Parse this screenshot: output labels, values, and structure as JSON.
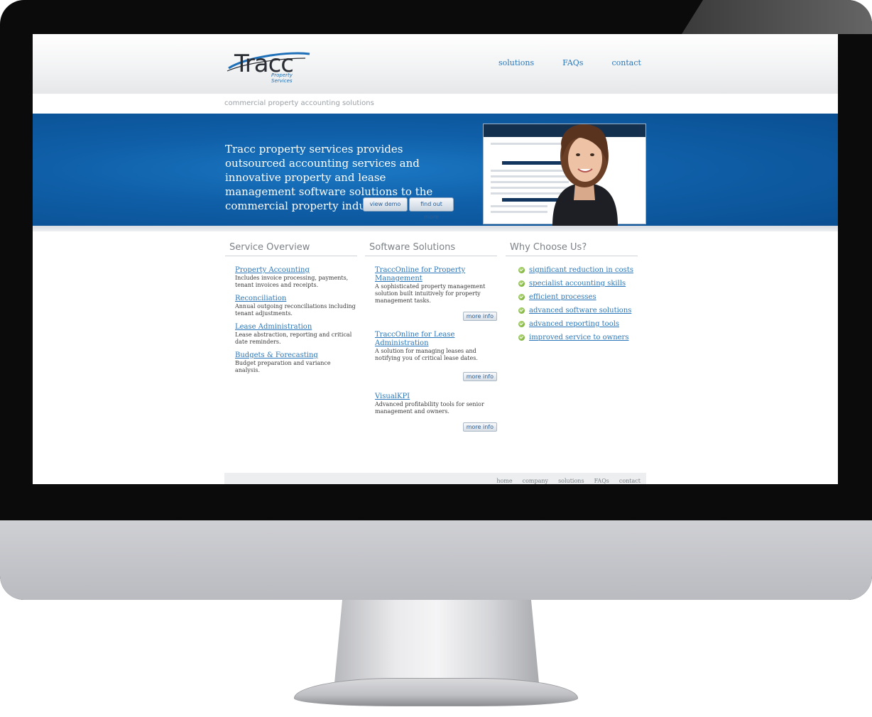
{
  "header": {
    "logo_text": "Tracc",
    "logo_sub": "Property Services",
    "nav": [
      "solutions",
      "FAQs",
      "contact"
    ]
  },
  "tagline": "commercial property accounting solutions",
  "banner": {
    "headline": "Tracc property services provides outsourced accounting services and innovative property and lease management software solutions to the commercial property industry.",
    "btn_demo": "view demo",
    "btn_more": "find out more"
  },
  "service_overview": {
    "heading": "Service Overview",
    "items": [
      {
        "title": "Property Accounting",
        "desc": "Includes invoice processing, payments, tenant invoices and receipts."
      },
      {
        "title": "Reconciliation",
        "desc": "Annual outgoing reconciliations including tenant adjustments."
      },
      {
        "title": "Lease Administration",
        "desc": "Lease abstraction, reporting and critical date reminders."
      },
      {
        "title": "Budgets & Forecasting",
        "desc": "Budget preparation and variance analysis."
      }
    ]
  },
  "software_solutions": {
    "heading": "Software Solutions",
    "more_label": "more info",
    "items": [
      {
        "title": "TraccOnline for Property Management",
        "desc": "A sophisticated property management solution built intuitively for property management tasks."
      },
      {
        "title": "TraccOnline for Lease Administration",
        "desc": "A solution for managing leases and notifying you of critical lease dates."
      },
      {
        "title": "VisualKPI",
        "desc": "Advanced profitability tools for senior management and owners."
      }
    ]
  },
  "why_choose": {
    "heading": "Why Choose Us?",
    "items": [
      "significant reduction in costs",
      "specialist accounting skills",
      "efficient processes",
      "advanced software solutions",
      "advanced reporting tools",
      "improved service to owners"
    ]
  },
  "footer": {
    "nav": [
      "home",
      "company",
      "solutions",
      "FAQs",
      "contact"
    ]
  },
  "colors": {
    "link": "#2a76b8",
    "banner": "#0f5fa8",
    "bezel": "#0b0b0b",
    "check": "#6aa426"
  }
}
